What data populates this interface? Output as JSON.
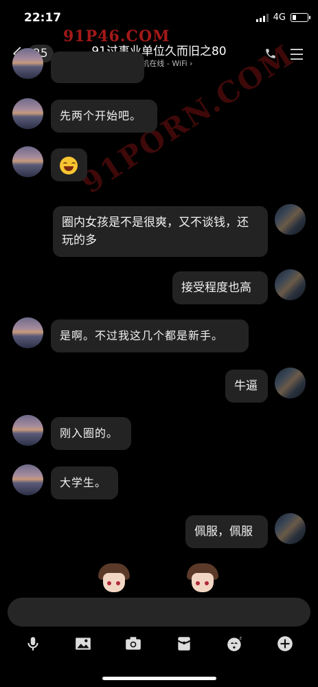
{
  "status": {
    "time": "22:17",
    "network": "4G"
  },
  "nav": {
    "back_count": "25",
    "title": "91过事业单位久而旧之80",
    "subtitle": "手机在线 - WiFi"
  },
  "watermarks": {
    "top": "91P46.COM",
    "diagonal": "91PORN.COM"
  },
  "messages": [
    {
      "side": "left",
      "text": "先两个开始吧。"
    },
    {
      "side": "left",
      "emoji": "laughing-tears"
    },
    {
      "side": "right",
      "text": "圈内女孩是不是很爽，又不谈钱，还玩的多"
    },
    {
      "side": "right",
      "text": "接受程度也高"
    },
    {
      "side": "left",
      "text": "是啊。不过我这几个都是新手。"
    },
    {
      "side": "right",
      "text": "牛逼"
    },
    {
      "side": "left",
      "text": "刚入圈的。"
    },
    {
      "side": "left",
      "text": "大学生。"
    },
    {
      "side": "right",
      "text": "佩服，佩服"
    }
  ],
  "toolbar": [
    "microphone-icon",
    "image-icon",
    "camera-icon",
    "red-packet-icon",
    "emoji-icon",
    "plus-icon"
  ]
}
